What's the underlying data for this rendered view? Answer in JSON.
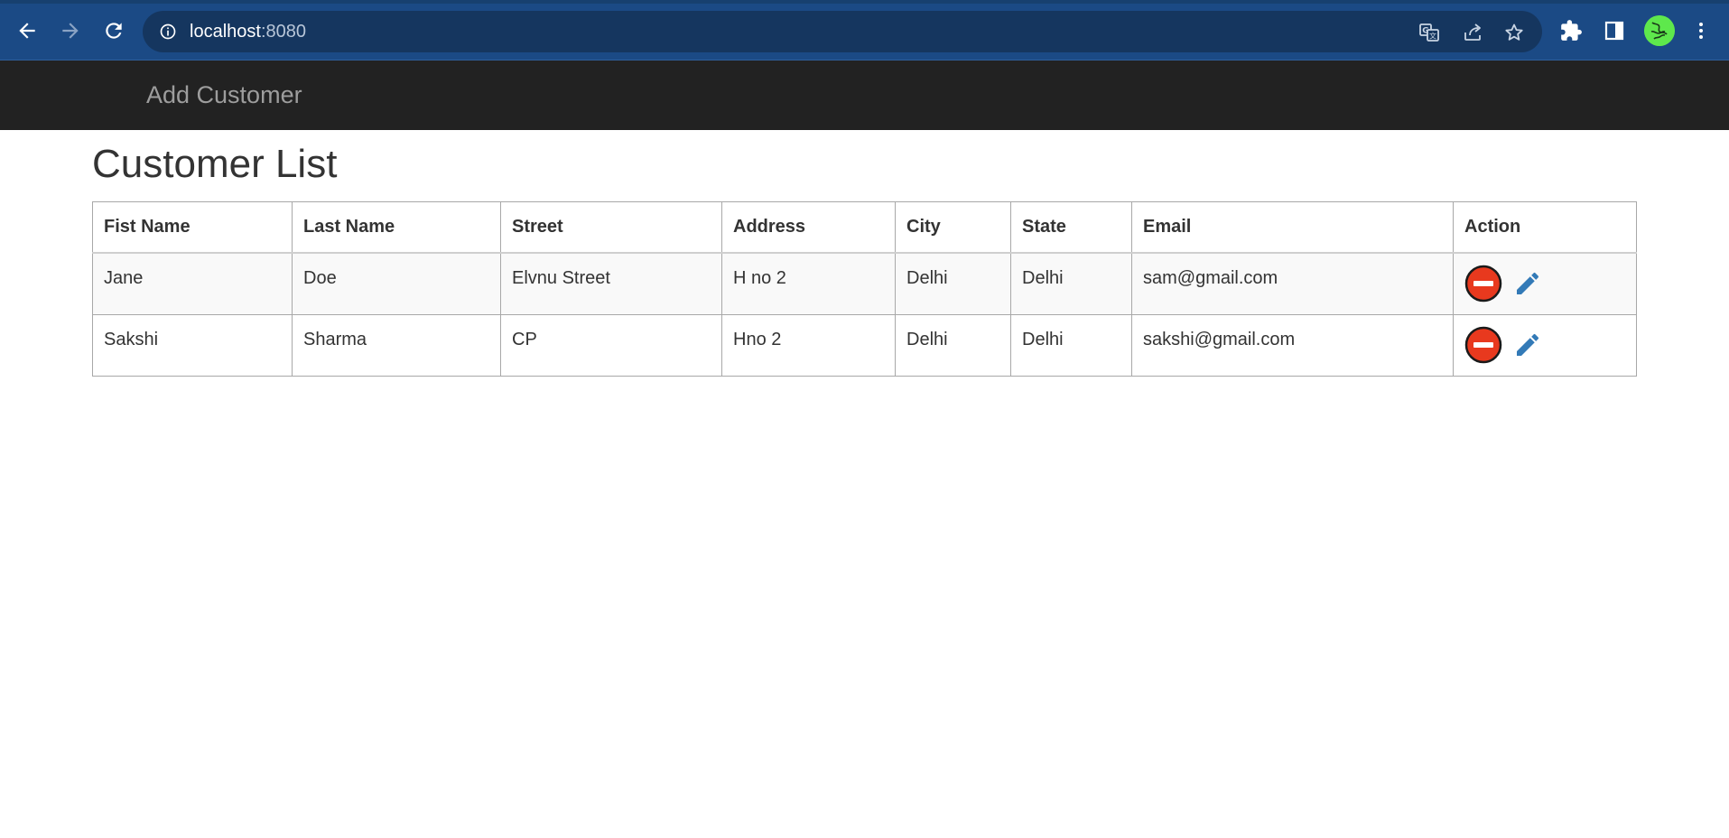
{
  "browser": {
    "url_host": "localhost",
    "url_port": ":8080",
    "icons": {
      "back": "arrow-left-icon",
      "forward": "arrow-right-icon",
      "reload": "reload-icon",
      "site_info": "info-icon",
      "translate": "translate-icon",
      "share": "share-icon",
      "bookmark": "star-icon",
      "extensions": "puzzle-icon",
      "side_panel": "side-panel-icon",
      "profile": "avatar",
      "menu": "kebab-menu-icon"
    },
    "colors": {
      "toolbar": "#1b4a85",
      "omnibox": "#15365f"
    }
  },
  "navbar": {
    "add_customer_label": "Add Customer",
    "background": "#222222",
    "link_color": "#9d9d9d"
  },
  "page": {
    "title": "Customer List"
  },
  "table": {
    "columns": [
      "Fist Name",
      "Last Name",
      "Street",
      "Address",
      "City",
      "State",
      "Email",
      "Action"
    ],
    "rows": [
      {
        "first_name": "Jane",
        "last_name": "Doe",
        "street": "Elvnu Street",
        "address": "H no 2",
        "city": "Delhi",
        "state": "Delhi",
        "email": "sam@gmail.com"
      },
      {
        "first_name": "Sakshi",
        "last_name": "Sharma",
        "street": "CP",
        "address": "Hno 2",
        "city": "Delhi",
        "state": "Delhi",
        "email": "sakshi@gmail.com"
      }
    ],
    "action_icons": {
      "delete": "minus-circle-icon",
      "edit": "pencil-icon"
    },
    "colors": {
      "delete": "#e8391e",
      "edit": "#337ab7"
    }
  }
}
